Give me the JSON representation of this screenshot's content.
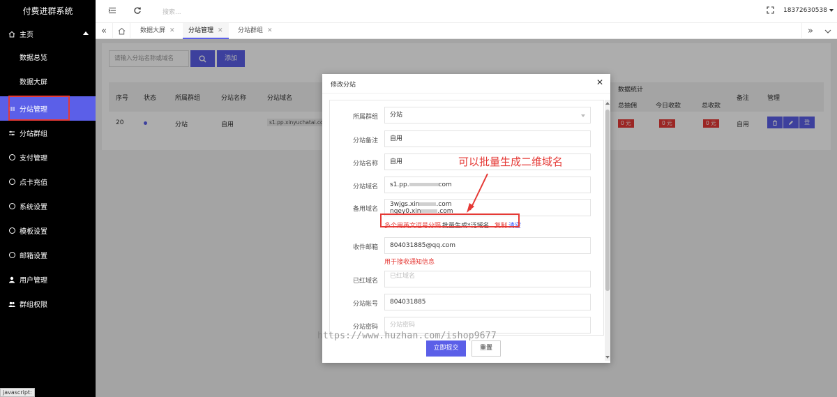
{
  "sidebar": {
    "logo": "付费进群系统",
    "items": [
      {
        "label": "主页",
        "icon": "home-icon"
      },
      {
        "label": "数据总览"
      },
      {
        "label": "数据大屏"
      },
      {
        "label": "分站管理",
        "icon": "columns-icon"
      },
      {
        "label": "分站群组",
        "icon": "sliders-icon"
      },
      {
        "label": "支付管理",
        "icon": "check-circle-icon"
      },
      {
        "label": "点卡充值",
        "icon": "check-circle-icon"
      },
      {
        "label": "系统设置",
        "icon": "check-circle-icon"
      },
      {
        "label": "模板设置",
        "icon": "check-circle-icon"
      },
      {
        "label": "邮箱设置",
        "icon": "check-circle-icon"
      },
      {
        "label": "用户管理",
        "icon": "user-icon"
      },
      {
        "label": "群组权限",
        "icon": "users-icon"
      }
    ],
    "active_index": 3
  },
  "header": {
    "search_placeholder": "搜索...",
    "username": "18372630538"
  },
  "tabs": [
    {
      "label": "数据大屏"
    },
    {
      "label": "分站管理",
      "active": true
    },
    {
      "label": "分站群组"
    }
  ],
  "toolbar": {
    "search_placeholder": "请输入分站名称或域名",
    "add_label": "添加"
  },
  "table": {
    "group_header": "数据统计",
    "headers": [
      "序号",
      "状态",
      "所属群组",
      "分站名称",
      "分站域名",
      "总抽佣",
      "今日收款",
      "总收款",
      "备注",
      "管理"
    ],
    "row": {
      "id": "20",
      "group": "分站",
      "name": "自用",
      "domain": "s1.pp.xinyuchatai.com",
      "commission": "0 元",
      "today": "0 元",
      "total": "0 元",
      "remark": "自用",
      "login_label": "登"
    }
  },
  "modal": {
    "title": "修改分站",
    "fields": {
      "group": {
        "label": "所属群组",
        "value": "分站"
      },
      "remark": {
        "label": "分站备注",
        "value": "自用"
      },
      "name": {
        "label": "分站名称",
        "value": "自用"
      },
      "domain": {
        "label": "分站域名",
        "value_prefix": "s1.pp.",
        "value_suffix": "com"
      },
      "backup": {
        "label": "备用域名",
        "line1_prefix": "3wjgs.xin",
        "line1_suffix": ".com",
        "line2_prefix": "ngey0.xin",
        "line2_suffix": ".com"
      },
      "email": {
        "label": "收件邮箱",
        "value": "804031885@qq.com"
      },
      "blocked": {
        "label": "已红域名",
        "placeholder": "已红域名"
      },
      "account": {
        "label": "分站帐号",
        "value": "804031885"
      },
      "password": {
        "label": "分站密码",
        "placeholder": "分站密码"
      }
    },
    "backup_hint": "多个用英文逗号分隔",
    "batch_label": "批量生成*泛域名",
    "copy_label": "复制",
    "clear_label": "清空",
    "email_hint": "用于接收通知信息",
    "submit_label": "立即提交",
    "reset_label": "重置"
  },
  "annotation": "可以批量生成二维域名",
  "watermark": "https://www.huzhan.com/ishop9677",
  "status_bar": "javascript:",
  "colors": {
    "accent": "#5b5fe8",
    "sidebar_bg": "#000000",
    "danger": "#e53935",
    "link": "#3355ff"
  }
}
